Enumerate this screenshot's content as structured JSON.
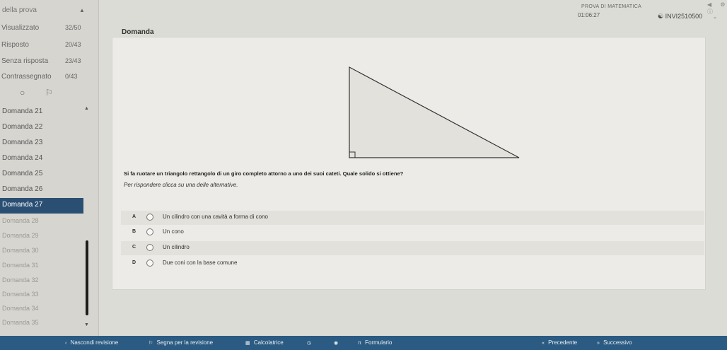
{
  "sidebar": {
    "header": "della prova",
    "stats": [
      {
        "label": "Visualizzato",
        "value": "32/50"
      },
      {
        "label": "Risposto",
        "value": "20/43"
      },
      {
        "label": "Senza risposta",
        "value": "23/43"
      },
      {
        "label": "Contrassegnato",
        "value": "0/43"
      }
    ],
    "questions": [
      {
        "label": "Domanda 21"
      },
      {
        "label": "Domanda 22"
      },
      {
        "label": "Domanda 23"
      },
      {
        "label": "Domanda 24"
      },
      {
        "label": "Domanda 25"
      },
      {
        "label": "Domanda 26"
      },
      {
        "label": "Domanda 27",
        "active": true
      },
      {
        "label": "Domanda 28"
      },
      {
        "label": "Domanda 29"
      },
      {
        "label": "Domanda 30"
      },
      {
        "label": "Domanda 31"
      },
      {
        "label": "Domanda 32"
      },
      {
        "label": "Domanda 33"
      },
      {
        "label": "Domanda 34"
      },
      {
        "label": "Domanda 35"
      }
    ]
  },
  "header": {
    "exam_title": "PROVA DI MATEMATICA",
    "timer": "01:06:27",
    "user": "INVI2510500"
  },
  "question": {
    "title": "Domanda",
    "text": "Si fa ruotare un triangolo rettangolo di un giro completo attorno a uno dei suoi cateti. Quale solido si ottiene?",
    "instruction": "Per rispondere clicca su una delle alternative.",
    "options": [
      {
        "key": "A",
        "text": "Un cilindro con una cavità a forma di cono"
      },
      {
        "key": "B",
        "text": "Un cono"
      },
      {
        "key": "C",
        "text": "Un cilindro"
      },
      {
        "key": "D",
        "text": "Due coni con la base comune"
      }
    ]
  },
  "bottombar": {
    "hide_review": "Nascondi revisione",
    "flag_review": "Segna per la revisione",
    "calculator": "Calcolatrice",
    "formulary": "Formulario",
    "prev": "Precedente",
    "next": "Successivo"
  }
}
